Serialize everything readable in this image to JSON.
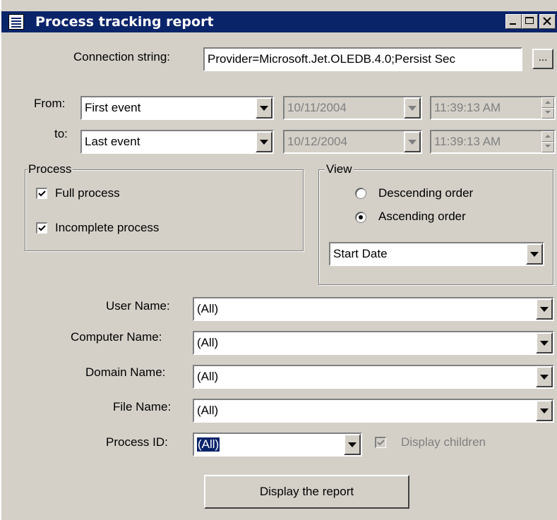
{
  "window": {
    "title": "Process tracking report",
    "system_icon": "report-icon",
    "controls": [
      "minimize-icon",
      "maximize-icon",
      "close-icon"
    ]
  },
  "connection": {
    "label": "Connection string:",
    "value": "Provider=Microsoft.Jet.OLEDB.4.0;Persist Sec",
    "browse_label": "..."
  },
  "range": {
    "from_label": "From:",
    "from_value": "First event",
    "from_date": "10/11/2004",
    "from_time": "11:39:13 AM",
    "to_label": "to:",
    "to_value": "Last event",
    "to_date": "10/12/2004",
    "to_time": "11:39:13 AM"
  },
  "process_group": {
    "label": "Process",
    "full_label": "Full process",
    "full_checked": true,
    "incomplete_label": "Incomplete process",
    "incomplete_checked": true
  },
  "view_group": {
    "label": "View",
    "descending_label": "Descending order",
    "ascending_label": "Ascending order",
    "selected": "ascending",
    "sort_value": "Start Date"
  },
  "filters": {
    "user_label": "User Name:",
    "user_value": "(All)",
    "computer_label": "Computer Name:",
    "computer_value": "(All)",
    "domain_label": "Domain Name:",
    "domain_value": "(All)",
    "file_label": "File Name:",
    "file_value": "(All)",
    "pid_label": "Process ID:",
    "pid_value": "(All)",
    "children_label": "Display children",
    "children_checked": true
  },
  "actions": {
    "display_label": "Display the report"
  },
  "colors": {
    "face": "#d4d0c8",
    "titlebar": "#0a246a",
    "selection": "#0a246a"
  }
}
